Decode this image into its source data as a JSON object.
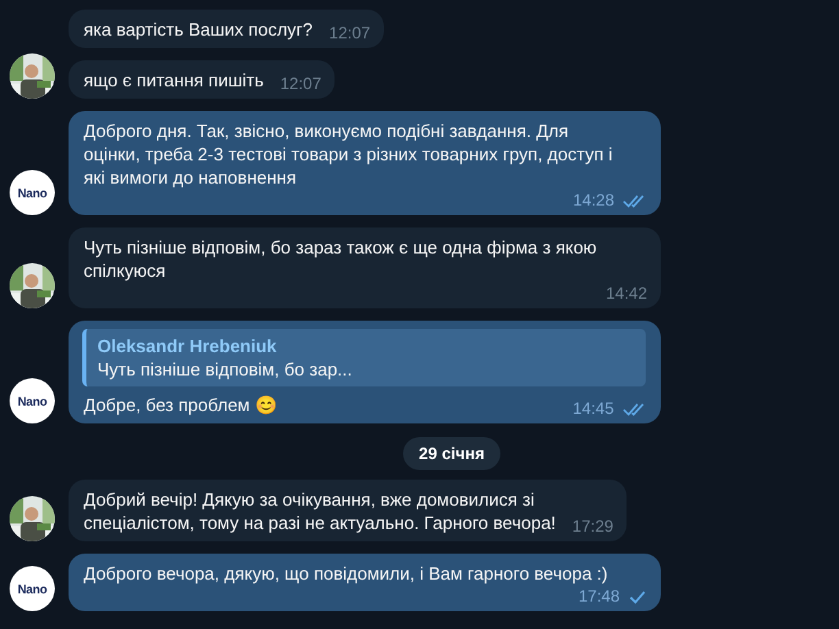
{
  "messages": [
    {
      "kind": "message",
      "outgoing": false,
      "text": "яка вартість Ваших послуг?",
      "time": "12:07"
    },
    {
      "kind": "message",
      "outgoing": false,
      "text": "ящо є питання пишіть",
      "time": "12:07"
    },
    {
      "kind": "message",
      "outgoing": true,
      "avatar": {
        "kind": "logo",
        "text": "Nano"
      },
      "text": "Доброго дня. Так, звісно, виконуємо подібні завдання. Для\nоцінки, треба 2-3 тестові товари з різних товарних груп, доступ і\nякі вимоги до наповнення",
      "time": "14:28",
      "read": true
    },
    {
      "kind": "message",
      "outgoing": false,
      "text": "Чуть пізніше відповім, бо зараз також є ще одна фірма з якою\nспілкуюся",
      "time": "14:42"
    },
    {
      "kind": "message",
      "outgoing": true,
      "avatar": {
        "kind": "logo",
        "text": "Nano"
      },
      "reply": {
        "name": "Oleksandr Hrebeniuk",
        "text": "Чуть пізніше відповім, бо зар..."
      },
      "text": "Добре, без проблем 😊",
      "time": "14:45",
      "read": true
    },
    {
      "kind": "date",
      "text": "29 січня"
    },
    {
      "kind": "message",
      "outgoing": false,
      "text": "Добрий вечір! Дякую за очікування, вже домовилися зі\nспеціалістом, тому на разі не актуально. Гарного вечора!",
      "time": "17:29"
    },
    {
      "kind": "message",
      "outgoing": true,
      "avatar": {
        "kind": "logo",
        "text": "Nano"
      },
      "text": "Доброго вечора, дякую, що повідомили, і Вам гарного вечора :)",
      "time": "17:48",
      "read": false
    }
  ]
}
